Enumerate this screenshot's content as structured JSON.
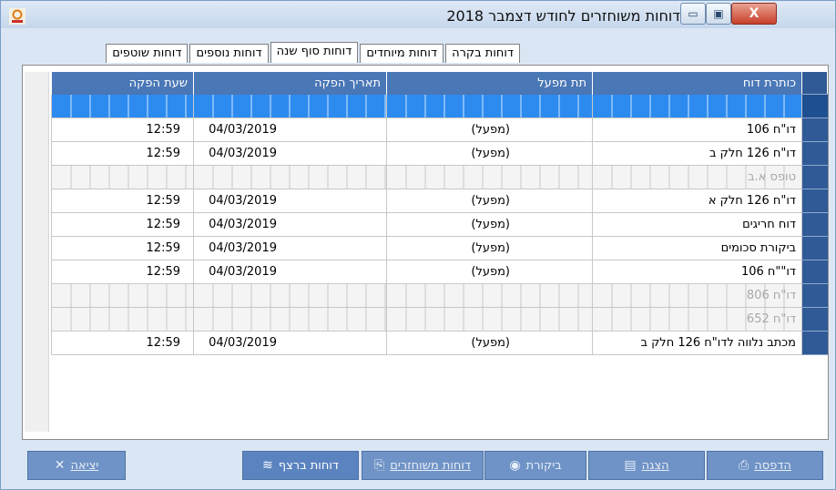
{
  "window": {
    "title": "דוחות משוחזרים לחודש דצמבר 2018",
    "buttons": {
      "minimize": "▭",
      "maximize": "▣",
      "close": "X"
    }
  },
  "tabs": [
    {
      "label": "דוחות בקרה",
      "active": false
    },
    {
      "label": "דוחות מיוחדים",
      "active": false
    },
    {
      "label": "דוחות סוף שנה",
      "active": true
    },
    {
      "label": "דוחות נוספים",
      "active": false
    },
    {
      "label": "דוחות שוטפים",
      "active": false
    }
  ],
  "grid": {
    "columns": [
      "כותרת דוח",
      "תת מפעל",
      "תאריך הפקה",
      "שעת הפקה"
    ],
    "rows": [
      {
        "title": "",
        "sub": "",
        "date": "",
        "time": "",
        "state": "selected"
      },
      {
        "title": "דו\"ח 106",
        "sub": "(מפעל)",
        "date": "04/03/2019",
        "time": "12:59",
        "state": "normal"
      },
      {
        "title": "דו\"ח 126 חלק ב",
        "sub": "(מפעל)",
        "date": "04/03/2019",
        "time": "12:59",
        "state": "normal"
      },
      {
        "title": "טופס א.ב",
        "sub": "",
        "date": "",
        "time": "",
        "state": "hatched"
      },
      {
        "title": "דו\"ח 126 חלק א",
        "sub": "(מפעל)",
        "date": "04/03/2019",
        "time": "12:59",
        "state": "normal"
      },
      {
        "title": "דוח חריגים",
        "sub": "(מפעל)",
        "date": "04/03/2019",
        "time": "12:59",
        "state": "normal"
      },
      {
        "title": "ביקורת סכומים",
        "sub": "(מפעל)",
        "date": "04/03/2019",
        "time": "12:59",
        "state": "normal"
      },
      {
        "title": "דו\"\"ח 106",
        "sub": "(מפעל)",
        "date": "04/03/2019",
        "time": "12:59",
        "state": "normal"
      },
      {
        "title": "דו\"ח 806",
        "sub": "",
        "date": "",
        "time": "",
        "state": "hatched"
      },
      {
        "title": "דו\"ח 652",
        "sub": "",
        "date": "",
        "time": "",
        "state": "hatched"
      },
      {
        "title": "מכתב נלווה לדו\"ח 126 חלק ב",
        "sub": "(מפעל)",
        "date": "04/03/2019",
        "time": "12:59",
        "state": "normal"
      }
    ]
  },
  "actions": {
    "print": "הדפסה",
    "show": "הצגה",
    "review": "ביקורת",
    "restored": "דוחות משוחזרים",
    "continuous": "דוחות ברצף",
    "exit": "יציאה"
  },
  "colors": {
    "header": "#4a77b6",
    "selected_row": "#2d8bf0",
    "button": "#6f93c6"
  }
}
